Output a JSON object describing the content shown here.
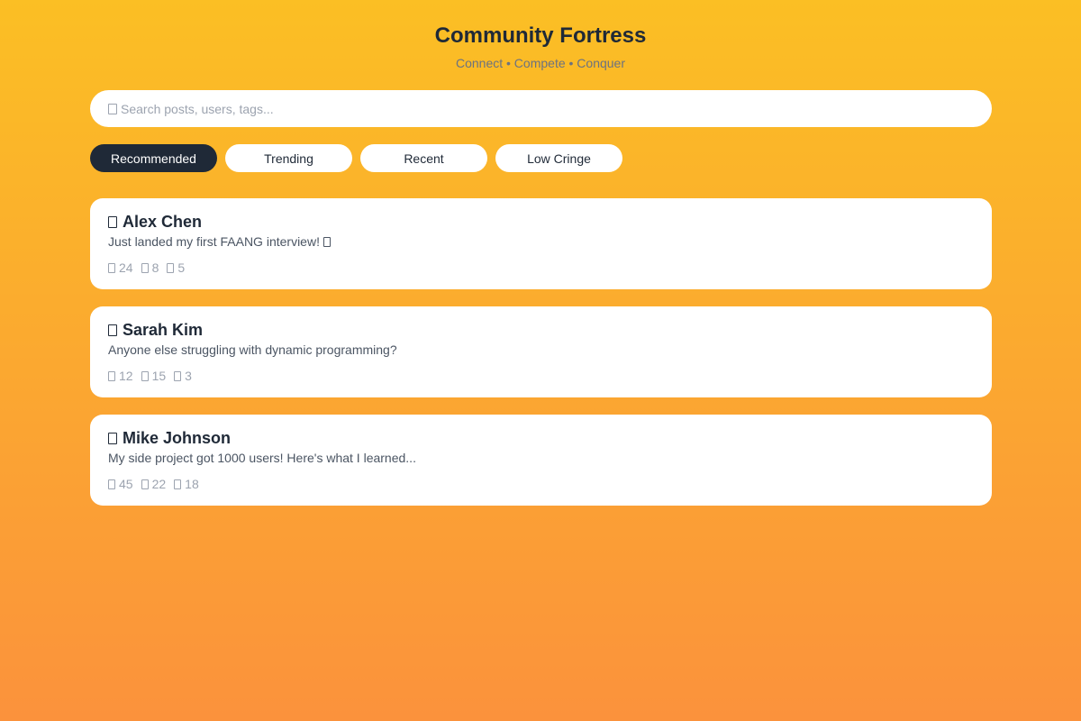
{
  "header": {
    "title": "Community Fortress",
    "subtitle": "Connect • Compete • Conquer"
  },
  "search": {
    "placeholder": "Search posts, users, tags...",
    "icon": "search-icon"
  },
  "tabs": [
    {
      "label": "Recommended",
      "active": true
    },
    {
      "label": "Trending",
      "active": false
    },
    {
      "label": "Recent",
      "active": false
    },
    {
      "label": "Low Cringe",
      "active": false
    }
  ],
  "posts": [
    {
      "author": "Alex Chen",
      "text": "Just landed my first FAANG interview!",
      "likes": "24",
      "comments": "8",
      "shares": "5"
    },
    {
      "author": "Sarah Kim",
      "text": "Anyone else struggling with dynamic programming?",
      "likes": "12",
      "comments": "15",
      "shares": "3"
    },
    {
      "author": "Mike Johnson",
      "text": "My side project got 1000 users! Here's what I learned...",
      "likes": "45",
      "comments": "22",
      "shares": "18"
    }
  ],
  "colors": {
    "background_top": "#fbbf24",
    "background_bottom": "#fb923c",
    "active_tab": "#1f2937",
    "card": "#ffffff",
    "muted_text": "#9ca3af"
  }
}
